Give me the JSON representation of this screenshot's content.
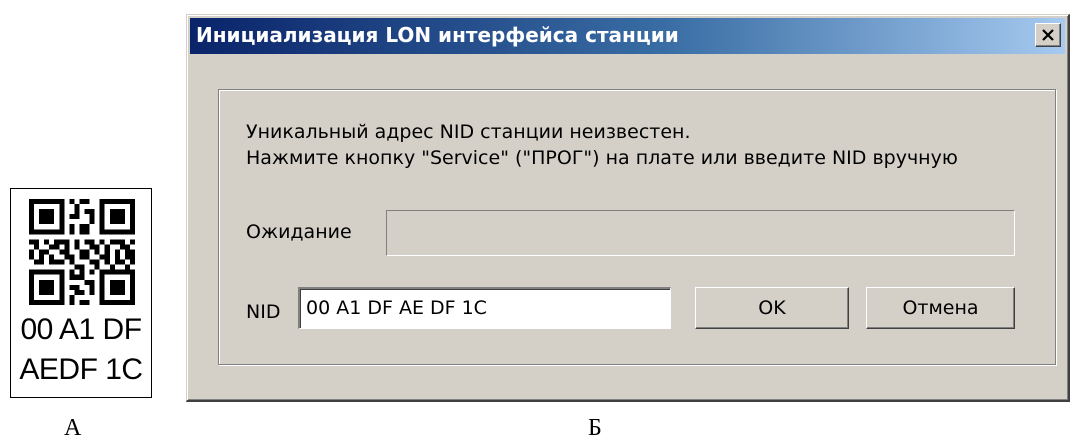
{
  "qr_label": {
    "line1": "00 A1 DF",
    "line2": "AEDF 1C"
  },
  "captions": {
    "a": "А",
    "b": "Б"
  },
  "dialog": {
    "title": "Инициализация LON интерфейса станции",
    "message_line1": "Уникальный адрес NID станции неизвестен.",
    "message_line2": "Нажмите кнопку \"Service\" (\"ПРОГ\") на плате или введите NID вручную",
    "wait_label": "Ожидание",
    "wait_progress": 0,
    "nid_label": "NID",
    "nid_value": "00 A1 DF AE DF 1C",
    "ok_label": "OK",
    "cancel_label": "Отмена",
    "close_icon": "close-x-icon"
  },
  "colors": {
    "titlebar_start": "#0a246a",
    "titlebar_end": "#a6caf0",
    "dialog_bg": "#d4d0c8"
  }
}
